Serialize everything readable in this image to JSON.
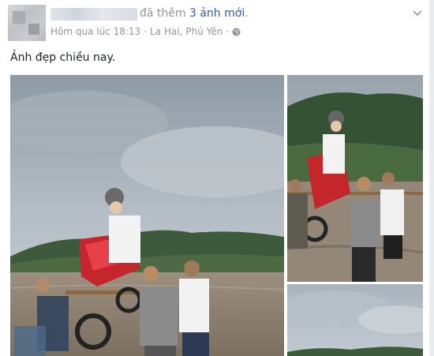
{
  "post": {
    "headline_action": "đã thêm",
    "headline_link": "3 ảnh mới",
    "headline_end": ".",
    "timestamp": "Hôm qua lúc 18:13",
    "separator": "·",
    "location": "La Hai, Phú Yên",
    "privacy_icon": "globe-icon",
    "menu_icon": "chevron-down-icon",
    "caption": "Ảnh đẹp chiều nay."
  },
  "colors": {
    "link": "#365899",
    "meta": "#90949c",
    "text": "#1d2129"
  }
}
